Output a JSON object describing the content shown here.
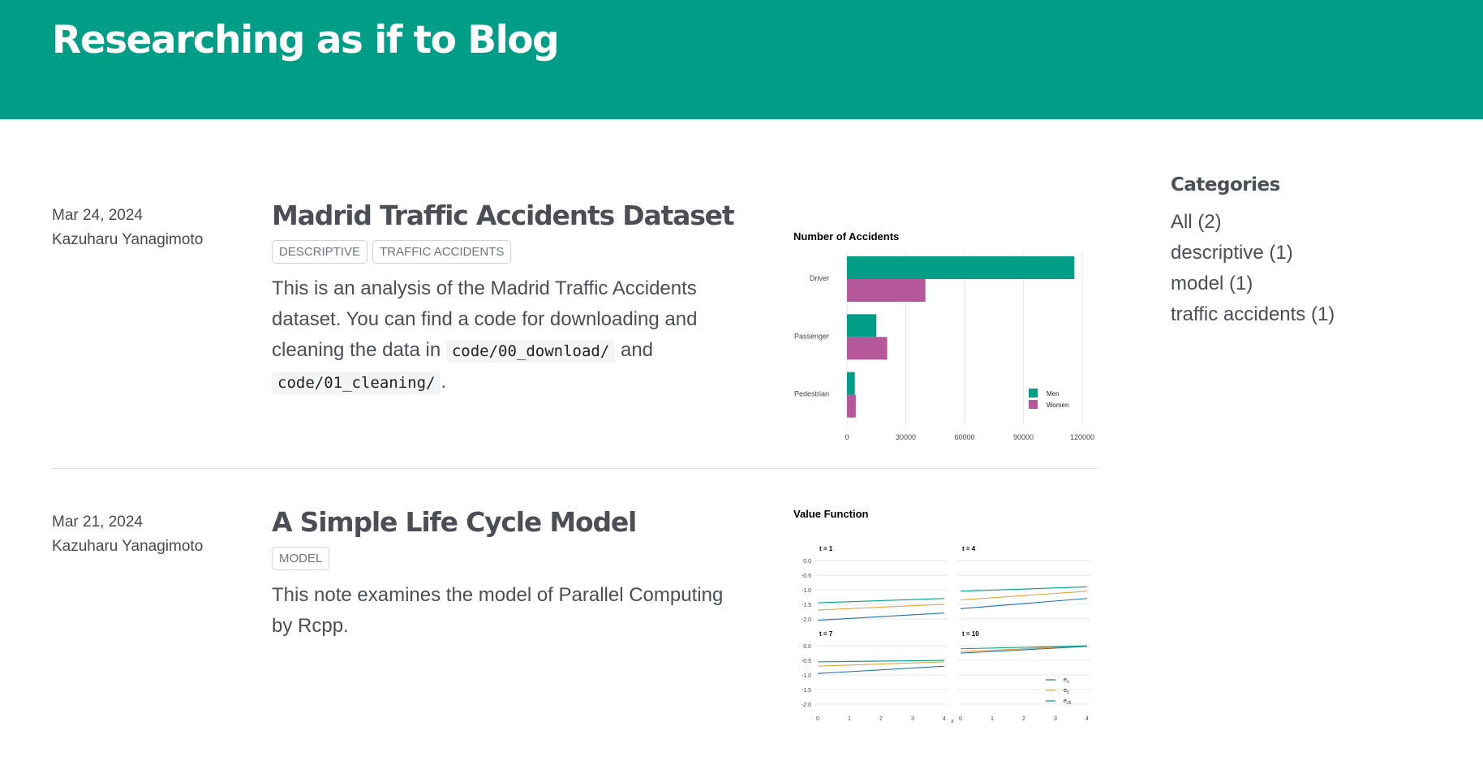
{
  "site_title": "Researching as if to Blog",
  "posts": [
    {
      "date": "Mar 24, 2024",
      "author": "Kazuharu Yanagimoto",
      "title": "Madrid Traffic Accidents Dataset",
      "categories": [
        "DESCRIPTIVE",
        "TRAFFIC ACCIDENTS"
      ],
      "desc_1": "This is an analysis of the Madrid Traffic Accidents dataset. You can find a code for downloading and cleaning the data in ",
      "code_1": "code/00_download/",
      "desc_2": " and ",
      "code_2": "code/01_cleaning/",
      "desc_3": "."
    },
    {
      "date": "Mar 21, 2024",
      "author": "Kazuharu Yanagimoto",
      "title": "A Simple Life Cycle Model",
      "categories": [
        "MODEL"
      ],
      "desc_1": "This note examines the model of Parallel Computing by Rcpp."
    }
  ],
  "sidebar": {
    "heading": "Categories",
    "items": [
      "All (2)",
      "descriptive (1)",
      "model (1)",
      "traffic accidents (1)"
    ]
  },
  "colors": {
    "banner": "#009e87",
    "men": "#009e87",
    "women": "#b5589b",
    "line_blue": "#1f6fb8",
    "line_orange": "#e8a33a",
    "line_green": "#009e87"
  },
  "chart_data": [
    {
      "type": "bar",
      "title": "Number of Accidents",
      "orientation": "horizontal",
      "categories": [
        "Driver",
        "Passenger",
        "Pedestrian"
      ],
      "series": [
        {
          "name": "Men",
          "values": [
            116000,
            15000,
            4000
          ]
        },
        {
          "name": "Women",
          "values": [
            40000,
            20500,
            4500
          ]
        }
      ],
      "x_ticks": [
        "0",
        "30000",
        "60000",
        "90000",
        "120000"
      ],
      "xlim": [
        0,
        120000
      ],
      "legend": "bottom-right"
    },
    {
      "type": "line",
      "title": "Value Function",
      "xlabel": "x",
      "x_ticks": [
        "0",
        "1",
        "2",
        "3",
        "4"
      ],
      "y_ticks": [
        "0.0",
        "-0.5",
        "-1.0",
        "-1.5",
        "-2.0"
      ],
      "ylim": [
        -2.2,
        0.2
      ],
      "legend": "bottom-right",
      "series_names": [
        "e1",
        "e5",
        "e15"
      ],
      "panels": [
        {
          "label": "t = 1",
          "series": [
            [
              -2.05,
              -1.8
            ],
            [
              -1.7,
              -1.5
            ],
            [
              -1.45,
              -1.3
            ]
          ]
        },
        {
          "label": "t = 4",
          "series": [
            [
              -1.65,
              -1.3
            ],
            [
              -1.35,
              -1.05
            ],
            [
              -1.05,
              -0.9
            ]
          ]
        },
        {
          "label": "t = 7",
          "series": [
            [
              -0.95,
              -0.7
            ],
            [
              -0.7,
              -0.55
            ],
            [
              -0.55,
              -0.5
            ]
          ]
        },
        {
          "label": "t = 10",
          "series": [
            [
              -0.25,
              -0.02
            ],
            [
              -0.2,
              0.0
            ],
            [
              -0.1,
              0.0
            ]
          ]
        }
      ]
    }
  ]
}
